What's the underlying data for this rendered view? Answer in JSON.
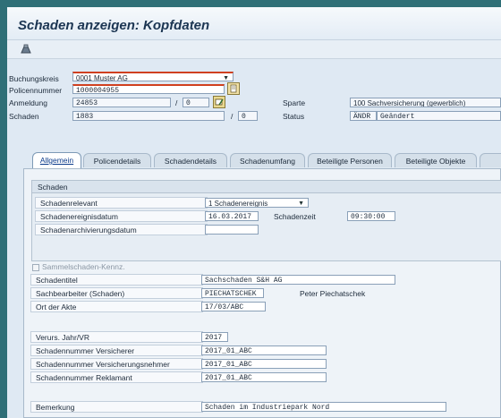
{
  "title": "Schaden anzeigen: Kopfdaten",
  "toolbar": {
    "icon": "other-object-icon"
  },
  "header": {
    "buchungskreis_label": "Buchungskreis",
    "buchungskreis_value": "0001 Muster AG",
    "policennummer_label": "Policennummer",
    "policennummer_value": "1000004955",
    "anmeldung_label": "Anmeldung",
    "anmeldung_value": "24853",
    "anmeldung_sep": "/",
    "anmeldung_sub": "0",
    "schaden_label": "Schaden",
    "schaden_value": "1883",
    "schaden_sep": "/",
    "schaden_sub": "0",
    "sparte_label": "Sparte",
    "sparte_value": "100 Sachversicherung (gewerblich)",
    "status_label": "Status",
    "status_code": "ÄNDR",
    "status_text": "Geändert"
  },
  "tabs": [
    {
      "label": "Allgemein"
    },
    {
      "label": "Policendetails"
    },
    {
      "label": "Schadendetails"
    },
    {
      "label": "Schadenumfang"
    },
    {
      "label": "Beteiligte Personen"
    },
    {
      "label": "Beteiligte Objekte"
    }
  ],
  "group": {
    "title": "Schaden",
    "schadenrelevant_label": "Schadenrelevant",
    "schadenrelevant_value": "1 Schadenereignis",
    "datum_label": "Schadenereignisdatum",
    "datum_value": "16.03.2017",
    "zeit_label": "Schadenzeit",
    "zeit_value": "09:30:00",
    "archiv_label": "Schadenarchivierungsdatum",
    "archiv_value": ""
  },
  "fields": {
    "sammel_label": "Sammelschaden-Kennz.",
    "titel_label": "Schadentitel",
    "titel_value": "Sachschaden S&H AG",
    "sachbearbeiter_label": "Sachbearbeiter (Schaden)",
    "sachbearbeiter_code": "PIECHATSCHEK",
    "sachbearbeiter_name": "Peter Piechatschek",
    "ort_label": "Ort der Akte",
    "ort_value": "17/03/ABC",
    "jahr_label": "Verurs. Jahr/VR",
    "jahr_value": "2017",
    "nr_versicherer_label": "Schadennummer Versicherer",
    "nr_versicherer_value": "2017_01_ABC",
    "nr_vn_label": "Schadennummer Versicherungsnehmer",
    "nr_vn_value": "2017_01_ABC",
    "nr_rekl_label": "Schadennummer Reklamant",
    "nr_rekl_value": "2017_01_ABC",
    "bemerkung_label": "Bemerkung",
    "bemerkung_value": "Schaden im Industriepark Nord"
  },
  "colors": {
    "frame": "#2f6f77",
    "background": "#dfe9f3",
    "active_tab_text": "#0a3a8a",
    "required_marker": "#d04020"
  }
}
